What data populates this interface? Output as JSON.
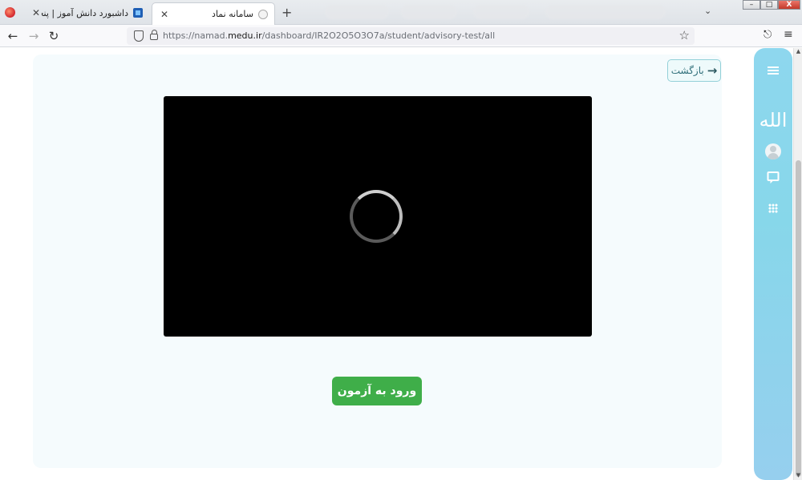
{
  "browser": {
    "tabs": [
      {
        "title": "داشبورد دانش آموز | پنجره واحد خ...",
        "icon": "medu-logo-icon",
        "active": false
      },
      {
        "title": "سامانه نماد",
        "icon": "page-favicon-icon",
        "active": true
      }
    ],
    "new_tab_label": "+",
    "tab_close_label": "✕",
    "url": {
      "protocol": "https://namad.",
      "domain": "medu.ir",
      "path": "/dashboard/IR2O2O5O3O7a/student/advisory-test/all"
    },
    "window_controls": {
      "minimize": "–",
      "maximize": "□",
      "close": "X"
    }
  },
  "page": {
    "back_button_label": "بازگشت",
    "enter_exam_button_label": "ورود به آزمون",
    "video": {
      "state": "loading"
    }
  },
  "sidebar": {
    "items": [
      {
        "icon": "hamburger-menu-icon"
      },
      {
        "icon": "iran-emblem-icon"
      },
      {
        "icon": "user-avatar-icon"
      },
      {
        "icon": "chat-icon"
      },
      {
        "icon": "apps-grid-icon"
      }
    ]
  },
  "colors": {
    "accent_green": "#3fae49",
    "sidebar_blue": "#8ed7ee",
    "back_border": "#93d0d8"
  }
}
